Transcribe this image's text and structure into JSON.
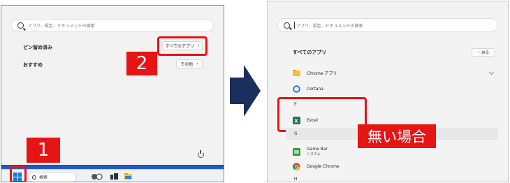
{
  "left_panel": {
    "search_placeholder": "アプリ、設定、ドキュメントの検索",
    "pinned_label": "ピン留め済み",
    "all_apps_button": "すべてのアプリ",
    "recommended_label": "おすすめ",
    "more_button": "その他",
    "step1_badge": "1",
    "step2_badge": "2",
    "taskbar_search": "検索"
  },
  "right_panel": {
    "search_placeholder": "アプリ、設定、ドキュメントの検索",
    "all_apps_title": "すべてのアプリ",
    "back_button": "戻る",
    "apps": [
      {
        "name": "Chrome アプリ",
        "icon": "folder-icon"
      },
      {
        "name": "Cortana",
        "icon": "cortana-icon"
      },
      {
        "name": "Excel",
        "icon": "excel-icon"
      },
      {
        "name": "Game Bar",
        "sub": "システム",
        "icon": "gamebar-icon"
      },
      {
        "name": "Google Chrome",
        "icon": "chrome-icon"
      }
    ],
    "letter_e": "E",
    "letter_g": "G",
    "letter_h": "H",
    "callout": "無い場合"
  },
  "colors": {
    "accent_red": "#e61414",
    "arrow": "#1a2f5c"
  }
}
